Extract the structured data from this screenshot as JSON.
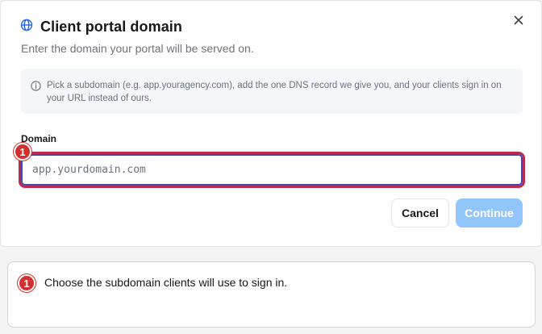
{
  "dialog": {
    "title": "Client portal domain",
    "subtitle": "Enter the domain your portal will be served on.",
    "title_icon": "globe-icon",
    "close_icon": "close-icon",
    "info": {
      "icon": "info-icon",
      "text": "Pick a subdomain (e.g. app.youragency.com), add the one DNS record we give you, and your clients sign in on your URL instead of ours."
    },
    "field": {
      "label": "Domain",
      "value": "",
      "placeholder": "app.yourdomain.com"
    },
    "buttons": {
      "cancel": "Cancel",
      "continue": "Continue"
    }
  },
  "annotation": {
    "number": "1",
    "text": "Choose the subdomain clients will use to sign in."
  },
  "colors": {
    "accent": "#93c5fd",
    "badge": "#d32f2f",
    "highlight_border": "#c0294e"
  }
}
